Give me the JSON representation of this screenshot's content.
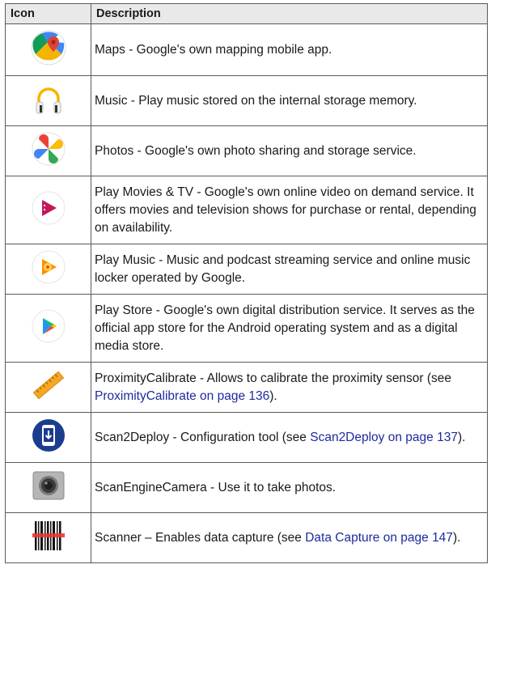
{
  "table": {
    "headers": [
      "Icon",
      "Description"
    ],
    "rows": [
      {
        "icon": "maps-icon",
        "text": "Maps - Google's own mapping mobile app."
      },
      {
        "icon": "music-headphones-icon",
        "text": "Music - Play music stored on the internal storage memory."
      },
      {
        "icon": "photos-pinwheel-icon",
        "text": "Photos - Google's own photo sharing and storage service."
      },
      {
        "icon": "play-movies-icon",
        "text": "Play Movies & TV - Google's own online video on demand service. It offers movies and television shows for purchase or rental, depending on availability."
      },
      {
        "icon": "play-music-icon",
        "text": "Play Music - Music and podcast streaming service and online music locker operated by Google."
      },
      {
        "icon": "play-store-icon",
        "text": "Play Store - Google's own digital distribution service. It serves as the official app store for the Android operating system and as a digital media store."
      },
      {
        "icon": "ruler-icon",
        "text_before": "ProximityCalibrate - Allows to calibrate the proximity sensor (see ",
        "link": "ProximityCalibrate on page 136",
        "text_after": ")."
      },
      {
        "icon": "scan2deploy-icon",
        "text_before": "Scan2Deploy - Configuration tool (see ",
        "link": "Scan2Deploy on page 137",
        "text_after": ")."
      },
      {
        "icon": "camera-icon",
        "text": "ScanEngineCamera - Use it to take photos."
      },
      {
        "icon": "barcode-scanner-icon",
        "text_before": "Scanner – Enables data capture (see ",
        "link": "Data Capture on page 147",
        "text_after": ")."
      }
    ]
  },
  "colors": {
    "link": "#1d2b9c",
    "header_bg": "#e9e9e9",
    "border": "#5a5a5a"
  }
}
